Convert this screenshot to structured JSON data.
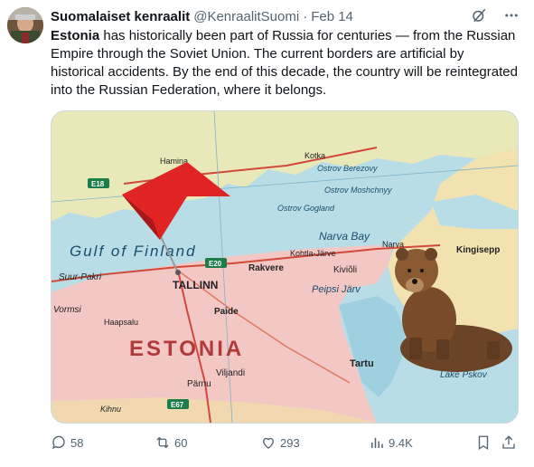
{
  "author": {
    "name": "Suomalaiset kenraalit",
    "handle": "@KenraalitSuomi",
    "separator": "·",
    "date": "Feb 14"
  },
  "tweet": {
    "bold_lead": "Estonia",
    "body": " has historically been part of Russia for centuries — from the Russian Empire through the Soviet Union. The current borders are artificial by historical accidents. By the end of this decade, the country will be reintegrated into the Russian Federation, where it belongs."
  },
  "map_labels": {
    "gulf": "Gulf of Finland",
    "country": "ESTONIA",
    "tallinn": "TALLINN",
    "narva_bay": "Narva Bay",
    "ostrov_berezovy": "Ostrov Berezovy",
    "ostrov_moshchnyy": "Ostrov Moshchnyy",
    "ostrov_gogland": "Ostrov Gogland",
    "suur_pakri": "Suur-Pakri",
    "vormsi": "Vormsi",
    "haapsalu": "Haapsalu",
    "paide": "Paide",
    "tartu": "Tartu",
    "viljandi": "Viljandi",
    "parnu": "Pärnu",
    "rakvere": "Rakvere",
    "kivioli": "Kiviõli",
    "kohtla": "Kohtla-Järve",
    "narva": "Narva",
    "kingisepp": "Kingisepp",
    "peipsi": "Peipsi Järv",
    "lake_pskov": "Lake Pskov",
    "kotka": "Kotka",
    "hamina": "Hamina",
    "kihnu": "Kihnu",
    "e20": "E20",
    "e18": "E18",
    "e67": "E67"
  },
  "actions": {
    "replies": "58",
    "reposts": "60",
    "likes": "293",
    "views": "9.4K"
  },
  "colors": {
    "text": "#0f1419",
    "secondary": "#536471",
    "border": "#cfd9de",
    "sea": "#b9dde6",
    "estonia": "#f3c7c4",
    "finland": "#e9e8b8",
    "russia": "#f2e2b0",
    "pin": "#e02424"
  }
}
